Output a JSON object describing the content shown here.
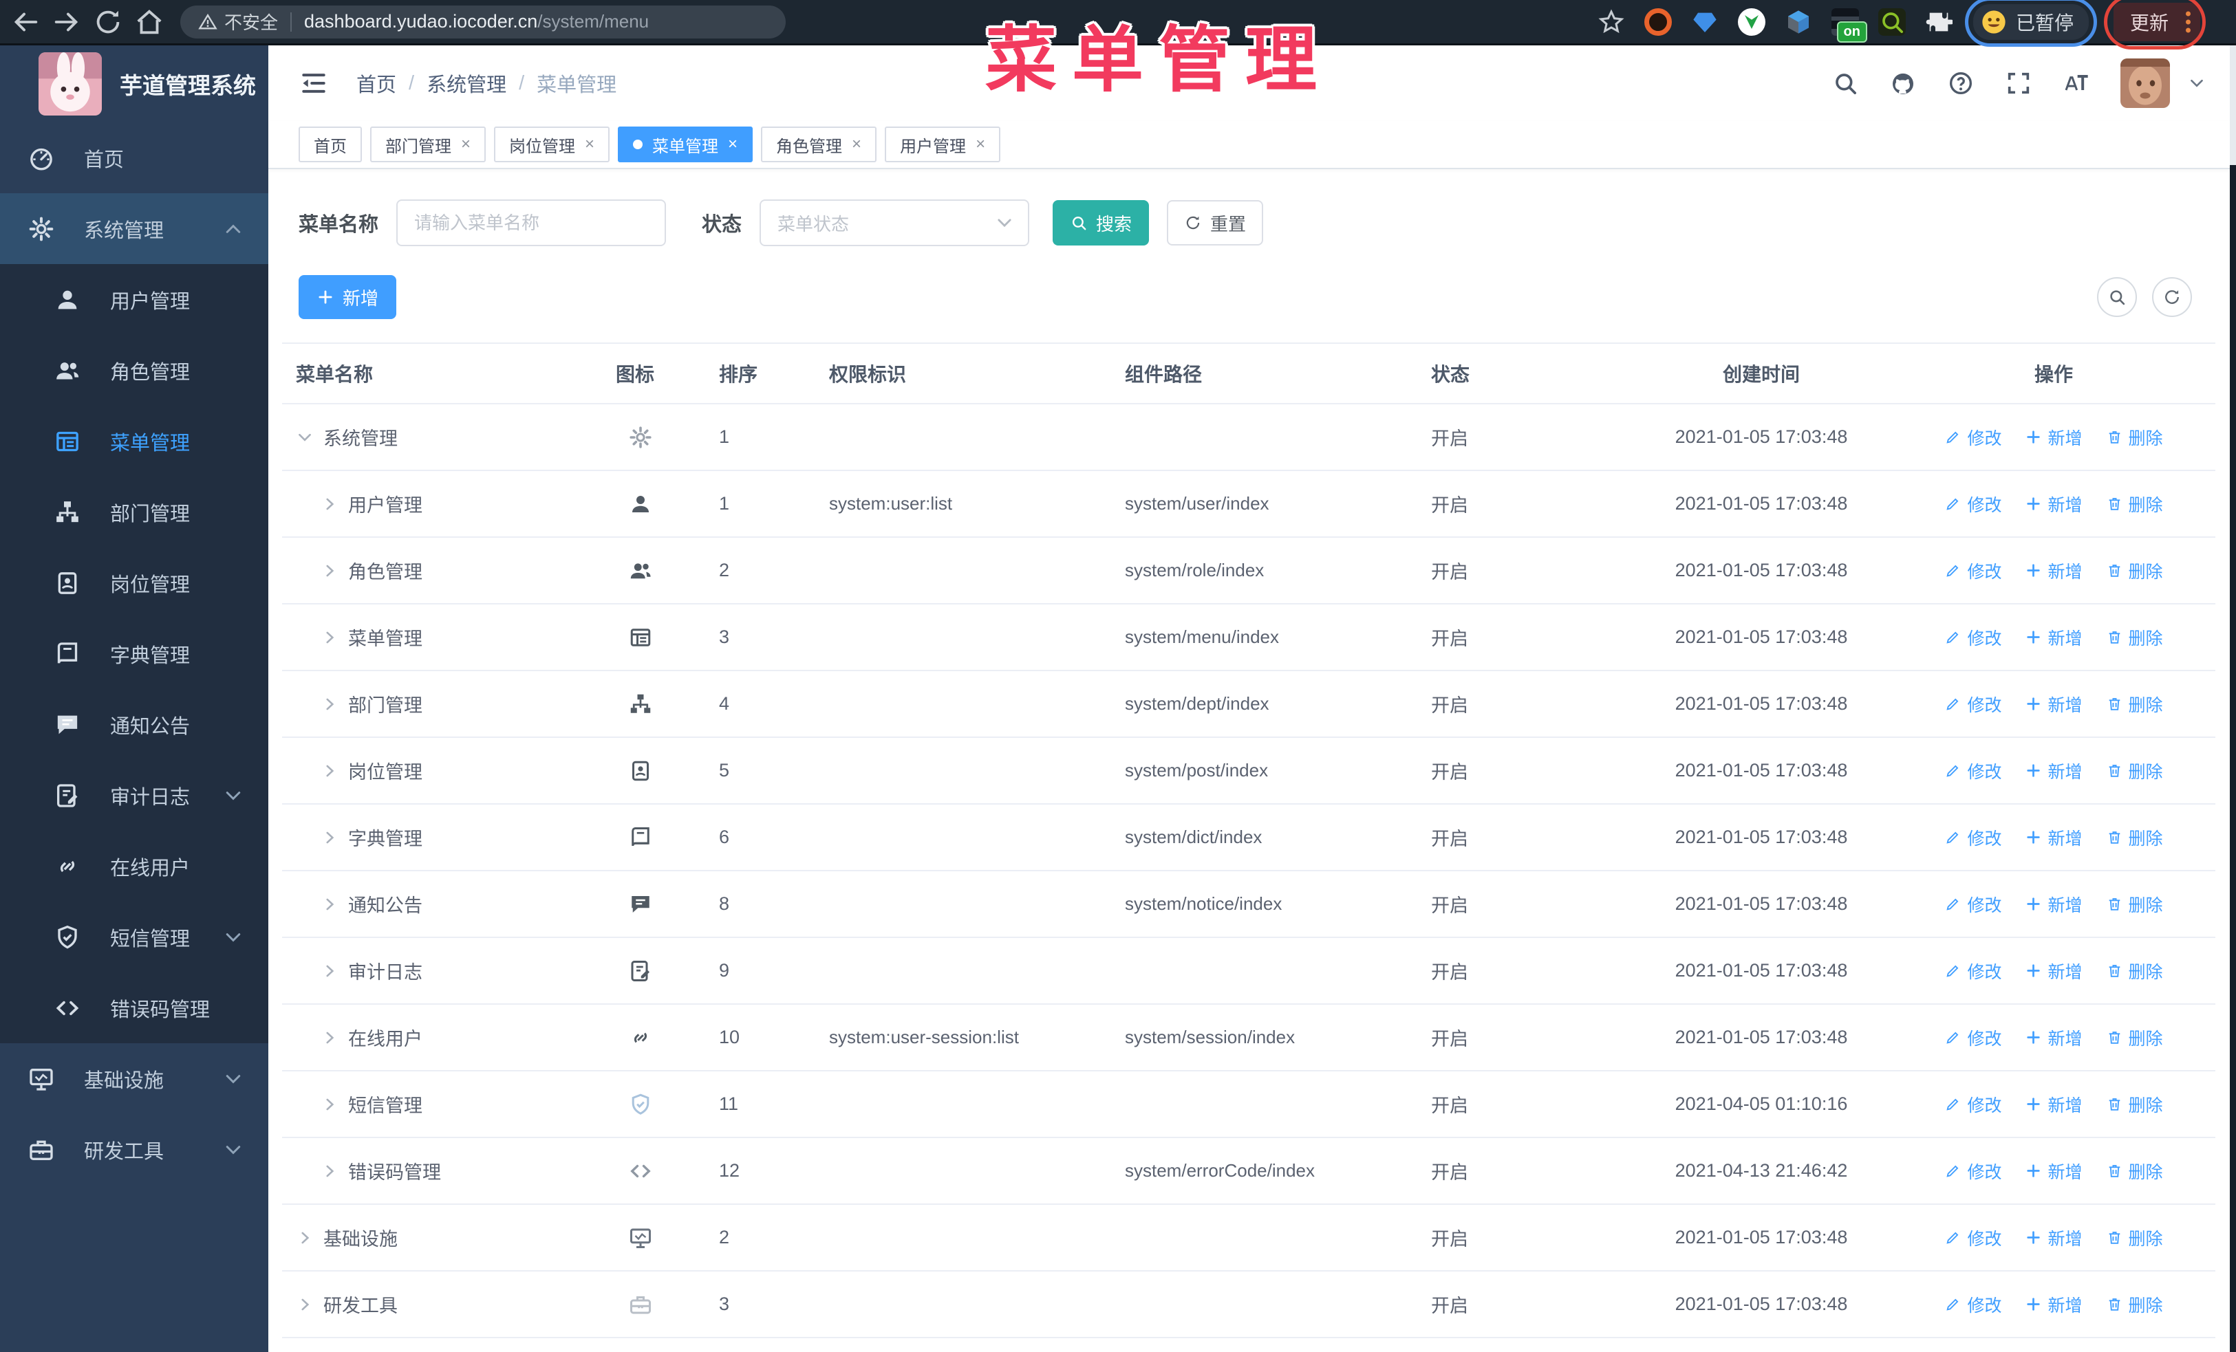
{
  "overlay_title": "菜单管理",
  "browser": {
    "security_label": "不安全",
    "url_host": "dashboard.yudao.iocoder.cn",
    "url_path": "/system/menu",
    "paused_badge": "已暂停",
    "update_button": "更新",
    "extension_on_badge": "on"
  },
  "sidebar": {
    "app_title": "芋道管理系统",
    "items": [
      {
        "label": "首页",
        "icon": "dashboard",
        "shade": "base"
      },
      {
        "label": "系统管理",
        "icon": "gear",
        "shade": "parent",
        "chevron": "up"
      },
      {
        "label": "用户管理",
        "icon": "user",
        "shade": "dark"
      },
      {
        "label": "角色管理",
        "icon": "users",
        "shade": "dark"
      },
      {
        "label": "菜单管理",
        "icon": "menu",
        "shade": "dark",
        "active": true
      },
      {
        "label": "部门管理",
        "icon": "tree",
        "shade": "dark"
      },
      {
        "label": "岗位管理",
        "icon": "badge",
        "shade": "dark"
      },
      {
        "label": "字典管理",
        "icon": "book",
        "shade": "dark"
      },
      {
        "label": "通知公告",
        "icon": "message",
        "shade": "dark"
      },
      {
        "label": "审计日志",
        "icon": "log",
        "shade": "dark",
        "chevron": "down"
      },
      {
        "label": "在线用户",
        "icon": "link",
        "shade": "dark"
      },
      {
        "label": "短信管理",
        "icon": "shield",
        "shade": "dark",
        "chevron": "down"
      },
      {
        "label": "错误码管理",
        "icon": "code",
        "shade": "dark"
      },
      {
        "label": "基础设施",
        "icon": "monitor",
        "shade": "base",
        "chevron": "down"
      },
      {
        "label": "研发工具",
        "icon": "toolbox",
        "shade": "base",
        "chevron": "down"
      }
    ]
  },
  "header": {
    "breadcrumb": [
      "首页",
      "系统管理",
      "菜单管理"
    ]
  },
  "tabs": [
    {
      "label": "首页",
      "closable": false,
      "active": false
    },
    {
      "label": "部门管理",
      "closable": true,
      "active": false
    },
    {
      "label": "岗位管理",
      "closable": true,
      "active": false
    },
    {
      "label": "菜单管理",
      "closable": true,
      "active": true
    },
    {
      "label": "角色管理",
      "closable": true,
      "active": false
    },
    {
      "label": "用户管理",
      "closable": true,
      "active": false
    }
  ],
  "filters": {
    "name_label": "菜单名称",
    "name_placeholder": "请输入菜单名称",
    "status_label": "状态",
    "status_placeholder": "菜单状态",
    "search_label": "搜索",
    "reset_label": "重置"
  },
  "toolbar": {
    "add_label": "新增"
  },
  "table": {
    "columns": [
      "菜单名称",
      "图标",
      "排序",
      "权限标识",
      "组件路径",
      "状态",
      "创建时间",
      "操作"
    ],
    "actions": {
      "edit": "修改",
      "add": "新增",
      "delete": "删除"
    },
    "rows": [
      {
        "name": "系统管理",
        "icon": "gear",
        "iconColor": "#9aa1ab",
        "level": 0,
        "caret": "down",
        "order": "1",
        "perm": "",
        "path": "",
        "status": "开启",
        "created": "2021-01-05 17:03:48"
      },
      {
        "name": "用户管理",
        "icon": "user",
        "level": 1,
        "caret": "right",
        "order": "1",
        "perm": "system:user:list",
        "path": "system/user/index",
        "status": "开启",
        "created": "2021-01-05 17:03:48"
      },
      {
        "name": "角色管理",
        "icon": "users",
        "level": 1,
        "caret": "right",
        "order": "2",
        "perm": "",
        "path": "system/role/index",
        "status": "开启",
        "created": "2021-01-05 17:03:48"
      },
      {
        "name": "菜单管理",
        "icon": "menu",
        "level": 1,
        "caret": "right",
        "order": "3",
        "perm": "",
        "path": "system/menu/index",
        "status": "开启",
        "created": "2021-01-05 17:03:48"
      },
      {
        "name": "部门管理",
        "icon": "tree",
        "level": 1,
        "caret": "right",
        "order": "4",
        "perm": "",
        "path": "system/dept/index",
        "status": "开启",
        "created": "2021-01-05 17:03:48"
      },
      {
        "name": "岗位管理",
        "icon": "badge",
        "level": 1,
        "caret": "right",
        "order": "5",
        "perm": "",
        "path": "system/post/index",
        "status": "开启",
        "created": "2021-01-05 17:03:48"
      },
      {
        "name": "字典管理",
        "icon": "book",
        "level": 1,
        "caret": "right",
        "order": "6",
        "perm": "",
        "path": "system/dict/index",
        "status": "开启",
        "created": "2021-01-05 17:03:48"
      },
      {
        "name": "通知公告",
        "icon": "message",
        "level": 1,
        "caret": "right",
        "order": "8",
        "perm": "",
        "path": "system/notice/index",
        "status": "开启",
        "created": "2021-01-05 17:03:48"
      },
      {
        "name": "审计日志",
        "icon": "log",
        "level": 1,
        "caret": "right",
        "order": "9",
        "perm": "",
        "path": "",
        "status": "开启",
        "created": "2021-01-05 17:03:48"
      },
      {
        "name": "在线用户",
        "icon": "link",
        "level": 1,
        "caret": "right",
        "order": "10",
        "perm": "system:user-session:list",
        "path": "system/session/index",
        "status": "开启",
        "created": "2021-01-05 17:03:48"
      },
      {
        "name": "短信管理",
        "icon": "shield",
        "iconColor": "#a9c3dd",
        "level": 1,
        "caret": "right",
        "order": "11",
        "perm": "",
        "path": "",
        "status": "开启",
        "created": "2021-04-05 01:10:16"
      },
      {
        "name": "错误码管理",
        "icon": "code",
        "iconColor": "#8f98a3",
        "level": 1,
        "caret": "right",
        "order": "12",
        "perm": "",
        "path": "system/errorCode/index",
        "status": "开启",
        "created": "2021-04-13 21:46:42"
      },
      {
        "name": "基础设施",
        "icon": "monitor",
        "iconColor": "#6b7480",
        "level": 0,
        "caret": "right",
        "order": "2",
        "perm": "",
        "path": "",
        "status": "开启",
        "created": "2021-01-05 17:03:48"
      },
      {
        "name": "研发工具",
        "icon": "toolbox",
        "iconColor": "#b9bfc7",
        "level": 0,
        "caret": "right",
        "order": "3",
        "perm": "",
        "path": "",
        "status": "开启",
        "created": "2021-01-05 17:03:48"
      }
    ]
  }
}
